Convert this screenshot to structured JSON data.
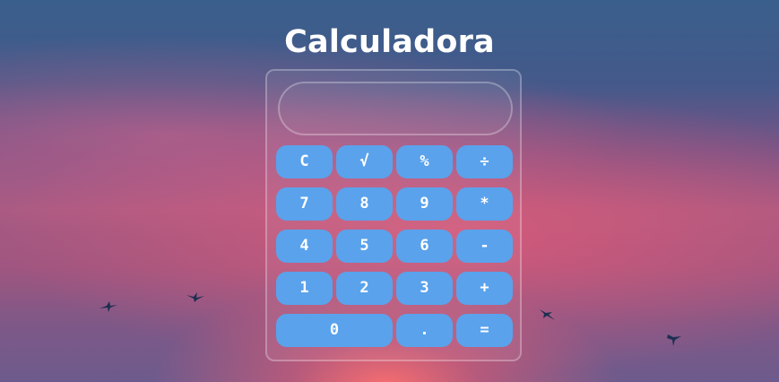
{
  "page": {
    "title": "Calculadora"
  },
  "calculator": {
    "display_value": "",
    "keys": {
      "clear": "C",
      "sqrt": "√",
      "percent": "%",
      "divide": "÷",
      "seven": "7",
      "eight": "8",
      "nine": "9",
      "multiply": "*",
      "four": "4",
      "five": "5",
      "six": "6",
      "subtract": "-",
      "one": "1",
      "two": "2",
      "three": "3",
      "add": "+",
      "zero": "0",
      "decimal": ".",
      "equals": "="
    }
  },
  "colors": {
    "button": "#5aa2ec",
    "button_text": "#ffffff",
    "title_text": "#ffffff"
  }
}
